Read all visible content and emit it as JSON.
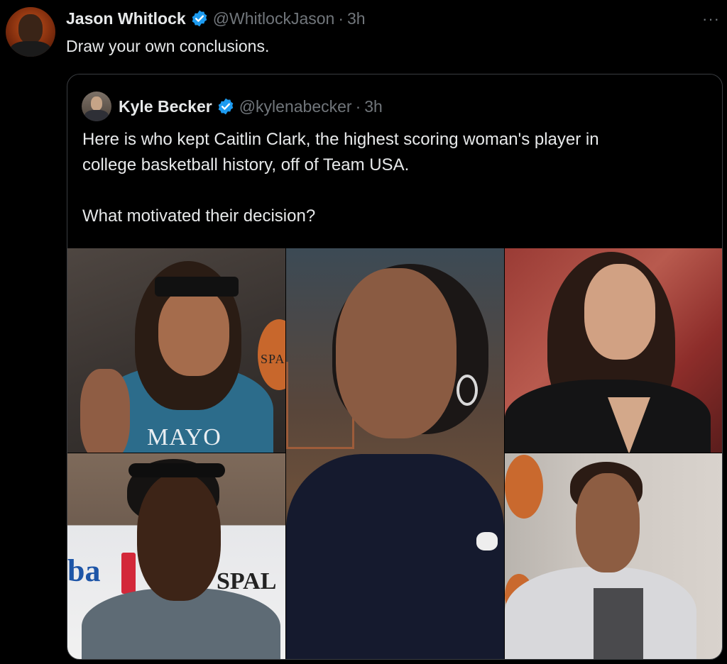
{
  "tweet": {
    "author_name": "Jason Whitlock",
    "handle": "@WhitlockJason",
    "separator": "·",
    "time": "3h",
    "text": "Draw your own conclusions.",
    "more_icon": "more-horizontal-icon",
    "more_label": "···"
  },
  "quoted_tweet": {
    "author_name": "Kyle Becker",
    "handle": "@kylenabecker",
    "separator": "·",
    "time": "3h",
    "line1": "Here is who kept Caitlin Clark, the highest scoring woman's player in",
    "line2": "college basketball history, off of Team USA.",
    "line3": "What motivated their decision?",
    "photos": {
      "p1_jersey": "MAYO",
      "p1_ball": "SPA",
      "p4_sign_left": "ba",
      "p4_sign_right": "SPAL"
    }
  },
  "colors": {
    "background": "#000000",
    "text": "#e7e9ea",
    "secondary": "#71767b",
    "verified": "#1d9bf0",
    "border": "#3a3d41"
  }
}
